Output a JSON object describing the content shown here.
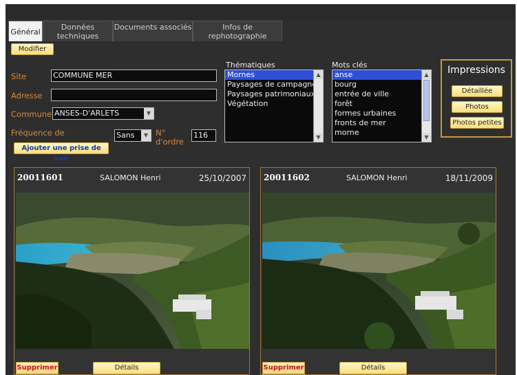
{
  "tabs": [
    {
      "label": "Général"
    },
    {
      "label": "Données techniques"
    },
    {
      "label": "Documents associés"
    },
    {
      "label": "Infos de rephotographie"
    }
  ],
  "buttons": {
    "modifier": "Modifier",
    "ajouter": "Ajouter une prise de vue",
    "detaillee": "Détaillée",
    "photos": "Photos",
    "photos_petites": "Photos petites",
    "supprimer": "Supprimer",
    "details": "Détails"
  },
  "form": {
    "site_label": "Site",
    "site_value": "COMMUNE MER",
    "adresse_label": "Adresse",
    "adresse_value": "",
    "commune_label": "Commune",
    "commune_value": "ANSES-D'ARLETS",
    "frequence_label": "Fréquence de rephotographie",
    "frequence_value": "Sans",
    "ordre_label": "N° d'ordre",
    "ordre_value": "116"
  },
  "thematiques": {
    "title": "Thématiques",
    "items": [
      "Mornes",
      "Paysages de campagne",
      "Paysages patrimoniaux",
      "Végétation"
    ],
    "selected_index": 0
  },
  "mots_cles": {
    "title": "Mots clés",
    "items": [
      "anse",
      "bourg",
      "entrée de ville",
      "forêt",
      "formes urbaines",
      "fronts de mer",
      "morne"
    ],
    "selected_index": 0
  },
  "impressions": {
    "title": "Impressions"
  },
  "photos": [
    {
      "number": "20011601",
      "author": "SALOMON Henri",
      "date": "25/10/2007"
    },
    {
      "number": "20011602",
      "author": "SALOMON Henri",
      "date": "18/11/2009"
    }
  ],
  "colors": {
    "accent_orange": "#d6883a",
    "selection_blue": "#2f4fd6",
    "panel_border": "#a6783a",
    "delete_red": "#c4141b"
  }
}
